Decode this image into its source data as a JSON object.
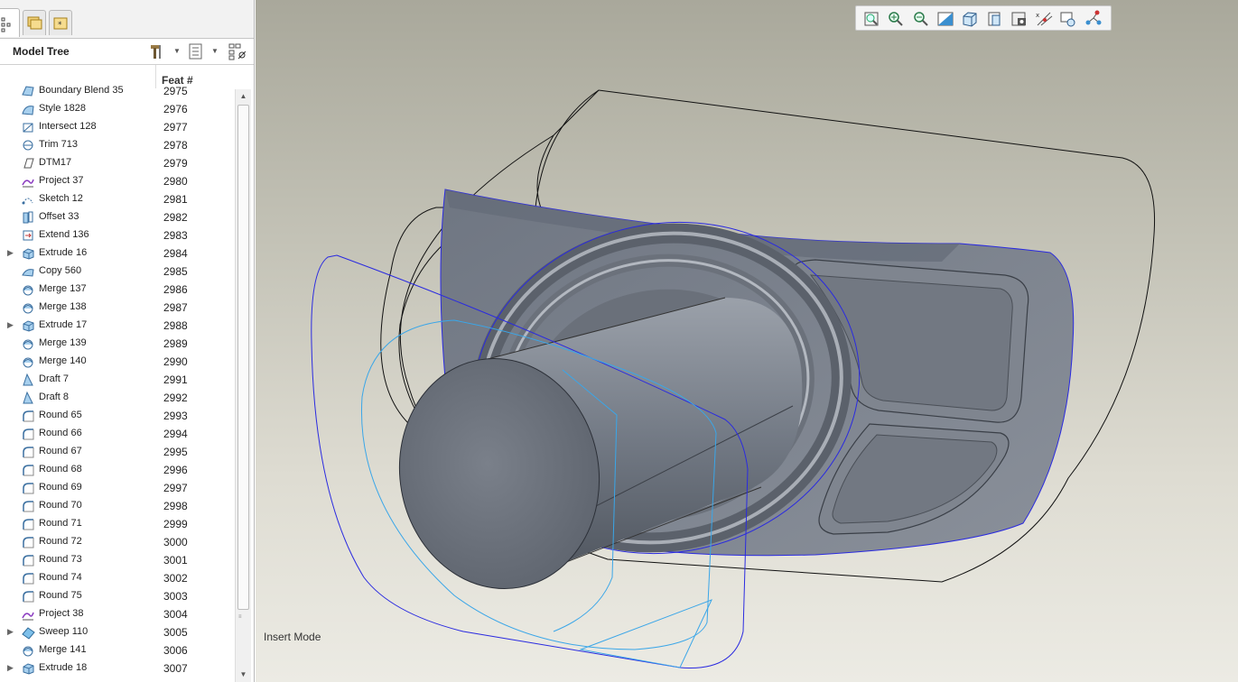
{
  "panel": {
    "title": "Model Tree",
    "column_header": "Feat #",
    "tabs": [
      "model-tree-tab",
      "folder-browser-tab",
      "favorites-tab"
    ]
  },
  "tree": [
    {
      "name": "Boundary Blend 35",
      "feat": "2975",
      "icon": "boundary-blend-icon",
      "expandable": false
    },
    {
      "name": "Style 1828",
      "feat": "2976",
      "icon": "style-icon",
      "expandable": false
    },
    {
      "name": "Intersect 128",
      "feat": "2977",
      "icon": "intersect-icon",
      "expandable": false
    },
    {
      "name": "Trim 713",
      "feat": "2978",
      "icon": "trim-icon",
      "expandable": false
    },
    {
      "name": "DTM17",
      "feat": "2979",
      "icon": "datum-plane-icon",
      "expandable": false
    },
    {
      "name": "Project 37",
      "feat": "2980",
      "icon": "project-icon",
      "expandable": false
    },
    {
      "name": "Sketch 12",
      "feat": "2981",
      "icon": "sketch-icon",
      "expandable": false
    },
    {
      "name": "Offset 33",
      "feat": "2982",
      "icon": "offset-icon",
      "expandable": false
    },
    {
      "name": "Extend 136",
      "feat": "2983",
      "icon": "extend-icon",
      "expandable": false
    },
    {
      "name": "Extrude 16",
      "feat": "2984",
      "icon": "extrude-icon",
      "expandable": true
    },
    {
      "name": "Copy 560",
      "feat": "2985",
      "icon": "copy-icon",
      "expandable": false
    },
    {
      "name": "Merge 137",
      "feat": "2986",
      "icon": "merge-icon",
      "expandable": false
    },
    {
      "name": "Merge 138",
      "feat": "2987",
      "icon": "merge-icon",
      "expandable": false
    },
    {
      "name": "Extrude 17",
      "feat": "2988",
      "icon": "extrude-icon",
      "expandable": true
    },
    {
      "name": "Merge 139",
      "feat": "2989",
      "icon": "merge-icon",
      "expandable": false
    },
    {
      "name": "Merge 140",
      "feat": "2990",
      "icon": "merge-icon",
      "expandable": false
    },
    {
      "name": "Draft 7",
      "feat": "2991",
      "icon": "draft-icon",
      "expandable": false
    },
    {
      "name": "Draft 8",
      "feat": "2992",
      "icon": "draft-icon",
      "expandable": false
    },
    {
      "name": "Round 65",
      "feat": "2993",
      "icon": "round-icon",
      "expandable": false
    },
    {
      "name": "Round 66",
      "feat": "2994",
      "icon": "round-icon",
      "expandable": false
    },
    {
      "name": "Round 67",
      "feat": "2995",
      "icon": "round-icon",
      "expandable": false
    },
    {
      "name": "Round 68",
      "feat": "2996",
      "icon": "round-icon",
      "expandable": false
    },
    {
      "name": "Round 69",
      "feat": "2997",
      "icon": "round-icon",
      "expandable": false
    },
    {
      "name": "Round 70",
      "feat": "2998",
      "icon": "round-icon",
      "expandable": false
    },
    {
      "name": "Round 71",
      "feat": "2999",
      "icon": "round-icon",
      "expandable": false
    },
    {
      "name": "Round 72",
      "feat": "3000",
      "icon": "round-icon",
      "expandable": false
    },
    {
      "name": "Round 73",
      "feat": "3001",
      "icon": "round-icon",
      "expandable": false
    },
    {
      "name": "Round 74",
      "feat": "3002",
      "icon": "round-icon",
      "expandable": false
    },
    {
      "name": "Round 75",
      "feat": "3003",
      "icon": "round-icon",
      "expandable": false
    },
    {
      "name": "Project 38",
      "feat": "3004",
      "icon": "project-icon",
      "expandable": false
    },
    {
      "name": "Sweep 110",
      "feat": "3005",
      "icon": "sweep-icon",
      "expandable": true
    },
    {
      "name": "Merge 141",
      "feat": "3006",
      "icon": "merge-icon",
      "expandable": false
    },
    {
      "name": "Extrude 18",
      "feat": "3007",
      "icon": "extrude-icon",
      "expandable": true
    }
  ],
  "view_toolbar": [
    "refit-icon",
    "zoom-in-icon",
    "zoom-out-icon",
    "repaint-icon",
    "display-style-icon",
    "saved-orientations-icon",
    "view-manager-icon",
    "datum-display-icon",
    "spin-center-icon",
    "annotation-display-icon"
  ],
  "status": "Insert Mode",
  "colors": {
    "selection_blue": "#2a2ae0",
    "sketch_cyan": "#3aa6e8",
    "surface_gray": "#7d838e"
  }
}
